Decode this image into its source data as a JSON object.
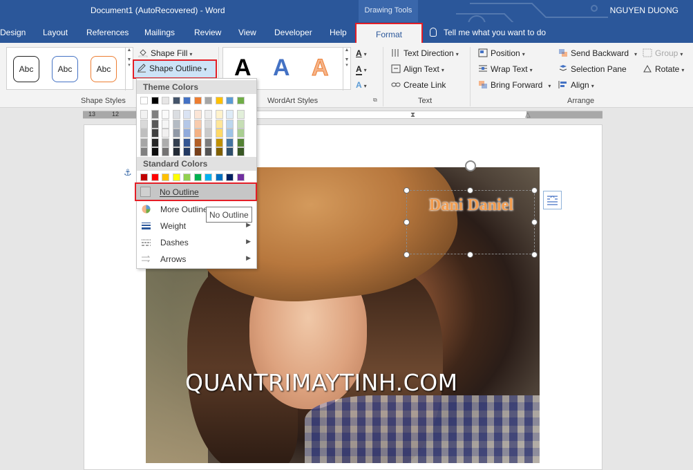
{
  "titlebar": {
    "document_title": "Document1 (AutoRecovered)  -  Word",
    "context_tab_group": "Drawing Tools",
    "user_name": "NGUYEN DUONG"
  },
  "tabs": {
    "design": "Design",
    "layout": "Layout",
    "references": "References",
    "mailings": "Mailings",
    "review": "Review",
    "view": "View",
    "developer": "Developer",
    "help": "Help",
    "format": "Format",
    "tell_me": "Tell me what you want to do"
  },
  "ribbon": {
    "shape_styles": {
      "label": "Shape Styles",
      "gallery": [
        "Abc",
        "Abc",
        "Abc"
      ],
      "shape_fill": "Shape Fill",
      "shape_outline": "Shape Outline"
    },
    "wordart_styles": {
      "label": "WordArt Styles",
      "samples": [
        "A",
        "A",
        "A"
      ]
    },
    "text": {
      "label": "Text",
      "text_direction": "Text Direction",
      "align_text": "Align Text",
      "create_link": "Create Link"
    },
    "arrange": {
      "label": "Arrange",
      "position": "Position",
      "wrap_text": "Wrap Text",
      "bring_forward": "Bring Forward",
      "send_backward": "Send Backward",
      "selection_pane": "Selection Pane",
      "align": "Align",
      "group": "Group",
      "rotate": "Rotate"
    }
  },
  "ruler": {
    "left_numbers": [
      "13",
      "12"
    ]
  },
  "dropdown": {
    "theme_colors_header": "Theme Colors",
    "standard_colors_header": "Standard Colors",
    "theme_top_row": [
      "#ffffff",
      "#000000",
      "#e7e6e6",
      "#44546a",
      "#4472c4",
      "#ed7d31",
      "#a5a5a5",
      "#ffc000",
      "#5b9bd5",
      "#70ad47"
    ],
    "standard_row": [
      "#c00000",
      "#ff0000",
      "#ffc000",
      "#ffff00",
      "#92d050",
      "#00b050",
      "#00b0f0",
      "#0070c0",
      "#002060",
      "#7030a0"
    ],
    "items": {
      "no_outline": "No Outline",
      "more_outline": "More Outline",
      "weight": "Weight",
      "dashes": "Dashes",
      "arrows": "Arrows"
    },
    "tooltip": "No Outline"
  },
  "document": {
    "textbox_text": "Dani Daniel",
    "watermark": "QUANTRIMAYTINH.COM"
  },
  "colors": {
    "word_blue": "#2b579a",
    "highlight_red": "#e41e26",
    "textbox_orange": "#f39c4e"
  }
}
